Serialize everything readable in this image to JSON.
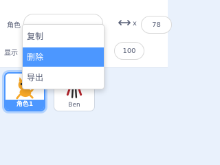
{
  "info_panel": {
    "sprite_label": "角色",
    "sprite_name_value": "角色1",
    "x_label": "x",
    "x_value": "78",
    "show_label": "显示",
    "size_value": "100"
  },
  "context_menu": {
    "items": [
      {
        "label": "复制",
        "highlighted": false
      },
      {
        "label": "删除",
        "highlighted": true
      },
      {
        "label": "导出",
        "highlighted": false
      }
    ]
  },
  "sprites": [
    {
      "name": "角色1",
      "selected": true,
      "icon": "cat-sprite-icon"
    },
    {
      "name": "Ben",
      "selected": false,
      "icon": "ben-sprite-icon"
    }
  ],
  "colors": {
    "accent": "#4c97ff",
    "text": "#575e75",
    "panel_bg": "#e9f1fc"
  }
}
